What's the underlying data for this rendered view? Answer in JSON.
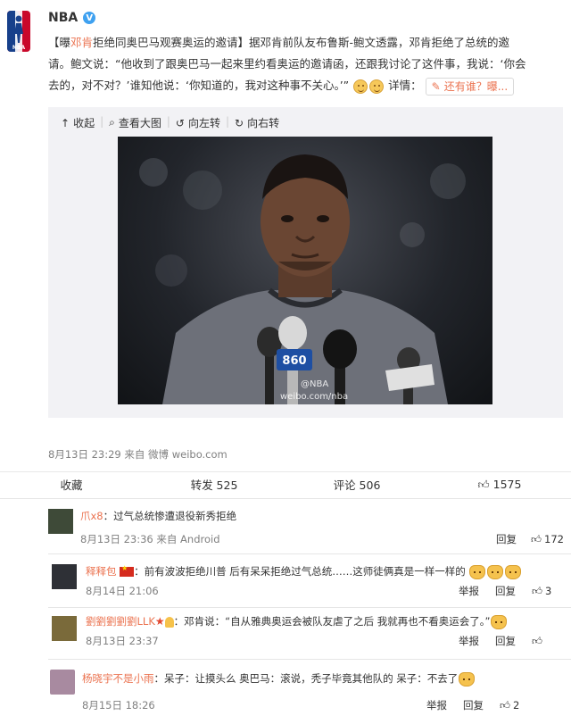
{
  "account": {
    "name": "NBA",
    "verified_mark": "V"
  },
  "post": {
    "headline_part1": "【曝",
    "headline_kw": "邓肯",
    "headline_part2": "拒绝同奥巴马观赛奥运的邀请】",
    "body_line1": "据邓肯前队友布鲁斯-鲍文透露，邓肯拒绝了总统的邀",
    "body_line2": "请。鲍文说：“他收到了跟奥巴马一起来里约看奥运的邀请函，还跟我讨论了这件事，我说：‘你会",
    "body_line3": "去的，对不对？’谁知他说：‘你知道的，我对这种事不关心。’”",
    "detail_label": "详情：",
    "detail_tag": "还有谁？曝..."
  },
  "media_bar": {
    "collapse": "收起",
    "view_large": "查看大图",
    "rotate_left": "向左转",
    "rotate_right": "向右转"
  },
  "photo": {
    "watermark_line1": "@NBA",
    "watermark_line2": "weibo.com/nba",
    "mic_label": "860"
  },
  "meta": {
    "time_source": "8月13日 23:29 来自 微博 weibo.com"
  },
  "actions": {
    "collect": "收藏",
    "repost": "转发 525",
    "comment": "评论 506",
    "like_count": "1575"
  },
  "comments": [
    {
      "name": "爪x8",
      "sep": "：",
      "text": "过气总统惨遭退役新秀拒绝",
      "time": "8月13日 23:36 来自 Android",
      "reply": "回复",
      "likes": "172"
    },
    {
      "name": "释释包",
      "sep": "：",
      "text": "前有波波拒绝川普 后有呆呆拒绝过气总统……这师徒俩真是一样一样的",
      "time": "8月14日 21:06",
      "report": "举报",
      "reply": "回复",
      "likes": "3"
    },
    {
      "name": "劉劉劉劉劉LLK",
      "sep": "：",
      "text": "邓肯说：“自从雅典奥运会被队友虐了之后 我就再也不看奥运会了。”",
      "time": "8月13日 23:37",
      "report": "举报",
      "reply": "回复",
      "likes": ""
    },
    {
      "name": "杨晓宇不是小雨",
      "sep": "：",
      "text": "呆子：让摸头么 奥巴马：滚说，秃子毕竟其他队的 呆子：不去了",
      "time": "8月15日 18:26",
      "report": "举报",
      "reply": "回复",
      "likes": "2"
    }
  ],
  "colors": {
    "accent": "#eb7350",
    "muted": "#808080",
    "media_bg": "#f2f2f5"
  }
}
